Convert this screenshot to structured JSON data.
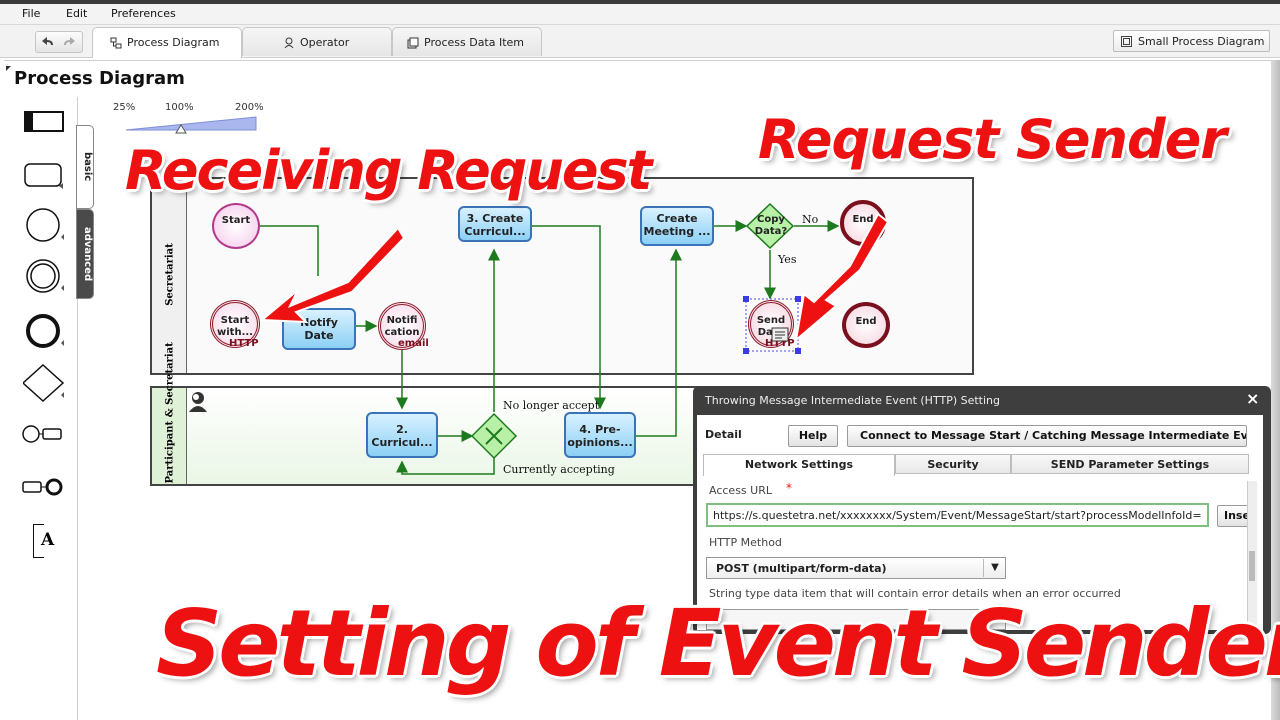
{
  "menu": {
    "file": "File",
    "edit": "Edit",
    "preferences": "Preferences"
  },
  "tabs": {
    "process_diagram": "Process Diagram",
    "operator": "Operator",
    "process_data_item": "Process Data Item"
  },
  "small_diagram_button": "Small Process Diagram",
  "page_title": "Process Diagram",
  "zoom": {
    "min": "25%",
    "mid": "100%",
    "max": "200%",
    "level": "100%"
  },
  "palette": {
    "basic_tab": "basic",
    "advanced_tab": "advanced",
    "text_tool": "A"
  },
  "lanes": {
    "secretariat": "Secretariat",
    "participant": "Participant & Secretariat"
  },
  "diagram": {
    "start": "Start",
    "start_http_line1": "Start",
    "start_http_line2": "with...",
    "start_http_sub": "HTTP",
    "notify_date_line1": "Notify",
    "notify_date_line2": "Date",
    "notification_line1": "Notifi",
    "notification_line2": "cation",
    "notification_sub": "email",
    "create_curricul_line1": "3. Create",
    "create_curricul_line2": "Curricul...",
    "create_meeting_line1": "Create",
    "create_meeting_line2": "Meeting ...",
    "copy_data_line1": "Copy",
    "copy_data_line2": "Data?",
    "no_label": "No",
    "yes_label": "Yes",
    "end_top": "End",
    "send_line1": "Send",
    "send_line2": "Data",
    "send_sub": "HTTP",
    "end_right": "End",
    "curricul2_line1": "2.",
    "curricul2_line2": "Curricul...",
    "pre_opinions_line1": "4. Pre-",
    "pre_opinions_line2": "opinions...",
    "no_longer_accept": "No longer accept",
    "currently_accepting": "Currently accepting"
  },
  "annotations": {
    "receiving_request": "Receiving Request",
    "request_sender": "Request Sender",
    "setting_event_sender": "Setting of Event Sender"
  },
  "dialog": {
    "title": "Throwing Message Intermediate Event (HTTP) Setting",
    "close": "×",
    "detail_label": "Detail",
    "help_button": "Help",
    "connect_button": "Connect to Message Start / Catching Message Intermediate Event (HTTP)",
    "tabs": {
      "network": "Network Settings",
      "security": "Security",
      "send_params": "SEND Parameter Settings"
    },
    "access_url_label": "Access URL",
    "required_mark": "*",
    "access_url_value": "https://s.questetra.net/xxxxxxxx/System/Event/MessageStart/start?processModelInfoId=",
    "insert_button": "Insert",
    "http_method_label": "HTTP Method",
    "http_method_value": "POST (multipart/form-data)",
    "error_label": "String type data item that will contain error details when an error occurred"
  },
  "colors": {
    "annotation_red": "#ee1111",
    "task_fill": "#8cd0f5",
    "task_border": "#3b73b9",
    "flow_green": "#1e7a1e",
    "end_event": "#7a0f1e",
    "start_event_fill": "#f4c8ea"
  }
}
